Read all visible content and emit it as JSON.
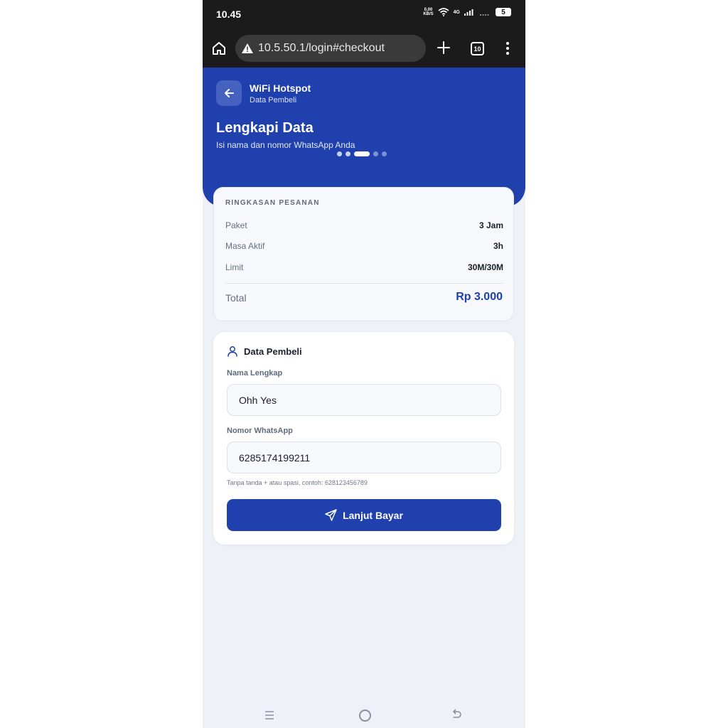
{
  "status_bar": {
    "time": "10.45",
    "net_speed_value": "0,00",
    "net_speed_unit": "KB/S",
    "network_type": "4G",
    "battery": "5"
  },
  "browser": {
    "url": "10.5.50.1/login#checkout",
    "tab_count": "10"
  },
  "header": {
    "app_title": "WiFi Hotspot",
    "app_subtitle": "Data Pembeli",
    "page_title": "Lengkapi Data",
    "page_subtitle": "Isi nama dan nomor WhatsApp Anda",
    "steps_total": 5,
    "current_step": 3
  },
  "summary": {
    "title": "RINGKASAN PESANAN",
    "rows": [
      {
        "label": "Paket",
        "value": "3 Jam"
      },
      {
        "label": "Masa Aktif",
        "value": "3h"
      },
      {
        "label": "Limit",
        "value": "30M/30M"
      }
    ],
    "total_label": "Total",
    "total_value": "Rp 3.000"
  },
  "form": {
    "title": "Data Pembeli",
    "name_label": "Nama Lengkap",
    "name_value": "Ohh Yes",
    "phone_label": "Nomor WhatsApp",
    "phone_value": "6285174199211",
    "hint": "Tanpa tanda + atau spasi, contoh: 628123456789",
    "submit_label": "Lanjut Bayar"
  },
  "colors": {
    "primary": "#1f40ad",
    "background": "#eef1f7",
    "status_bar": "#1b1b1b"
  }
}
